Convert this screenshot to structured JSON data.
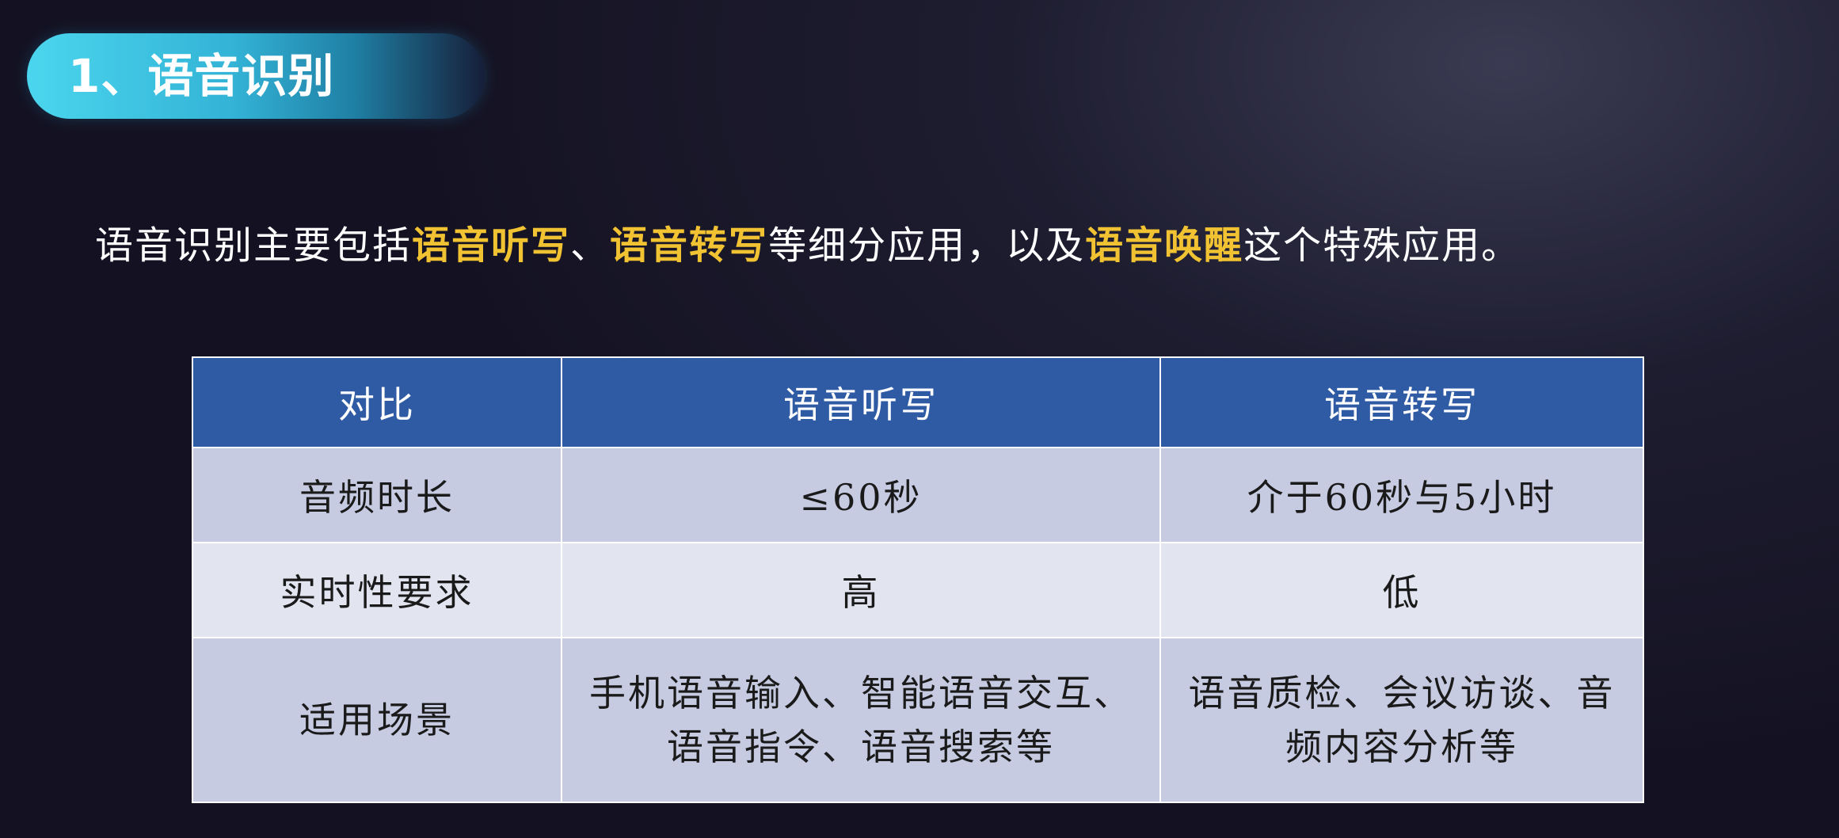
{
  "title": "1、语音识别",
  "intro": {
    "part1": "语音识别主要包括",
    "hl1": "语音听写",
    "part2": "、",
    "hl2": "语音转写",
    "part3": "等细分应用，以及",
    "hl3": "语音唤醒",
    "part4": "这个特殊应用。"
  },
  "table": {
    "headers": [
      "对比",
      "语音听写",
      "语音转写"
    ],
    "rows": [
      [
        "音频时长",
        "≤60秒",
        "介于60秒与5小时"
      ],
      [
        "实时性要求",
        "高",
        "低"
      ],
      [
        "适用场景",
        "手机语音输入、智能语音交互、语音指令、语音搜索等",
        "语音质检、会议访谈、音频内容分析等"
      ]
    ]
  },
  "colors": {
    "title_pill": "#3cc4e3",
    "highlight": "#f1c232",
    "header_bg": "#2f5aa4",
    "row_dark": "#c6cbe2",
    "row_light": "#e2e4f0"
  }
}
